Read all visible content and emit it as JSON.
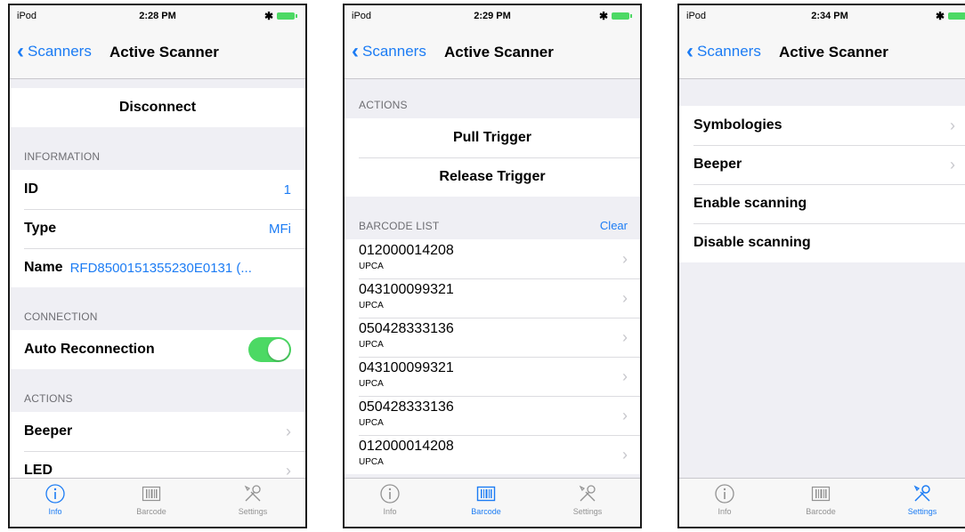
{
  "screens": [
    {
      "status": {
        "carrier": "iPod",
        "time": "2:28 PM"
      },
      "nav": {
        "back": "Scanners",
        "title": "Active Scanner"
      },
      "disconnect": "Disconnect",
      "info_header": "INFORMATION",
      "info": [
        {
          "label": "ID",
          "value": "1"
        },
        {
          "label": "Type",
          "value": "MFi"
        },
        {
          "label": "Name",
          "value": "RFD8500151355230E0131 (..."
        }
      ],
      "connection_header": "CONNECTION",
      "auto_reconnection": {
        "label": "Auto Reconnection",
        "on": true
      },
      "actions_header": "ACTIONS",
      "actions": [
        "Beeper",
        "LED"
      ],
      "active_tab": "Info"
    },
    {
      "status": {
        "carrier": "iPod",
        "time": "2:29 PM"
      },
      "nav": {
        "back": "Scanners",
        "title": "Active Scanner"
      },
      "actions_header": "ACTIONS",
      "actions": [
        "Pull Trigger",
        "Release Trigger"
      ],
      "barcode_header": "BARCODE LIST",
      "clear": "Clear",
      "barcodes": [
        {
          "code": "012000014208",
          "type": "UPCA"
        },
        {
          "code": "043100099321",
          "type": "UPCA"
        },
        {
          "code": "050428333136",
          "type": "UPCA"
        },
        {
          "code": "043100099321",
          "type": "UPCA"
        },
        {
          "code": "050428333136",
          "type": "UPCA"
        },
        {
          "code": "012000014208",
          "type": "UPCA"
        }
      ],
      "active_tab": "Barcode"
    },
    {
      "status": {
        "carrier": "iPod",
        "time": "2:34 PM"
      },
      "nav": {
        "back": "Scanners",
        "title": "Active Scanner"
      },
      "settings": [
        "Symbologies",
        "Beeper",
        "Enable scanning",
        "Disable scanning"
      ],
      "active_tab": "Settings"
    }
  ],
  "tabs": {
    "info": "Info",
    "barcode": "Barcode",
    "settings": "Settings"
  },
  "colors": {
    "accent": "#1c7cf4",
    "toggle_on": "#4cd964",
    "background": "#efeff4"
  }
}
